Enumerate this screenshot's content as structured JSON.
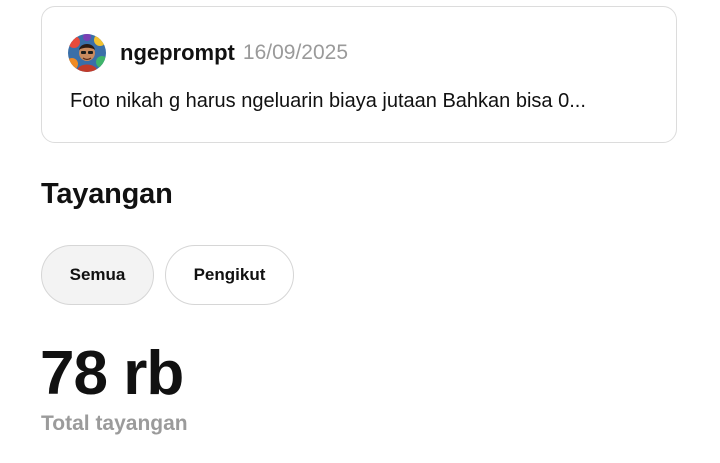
{
  "post": {
    "author": "ngeprompt",
    "date": "16/09/2025",
    "text": "Foto nikah g harus ngeluarin biaya jutaan Bahkan bisa 0..."
  },
  "views": {
    "title": "Tayangan",
    "filters": [
      "Semua",
      "Pengikut"
    ],
    "selected_filter": "Semua",
    "total_value": "78 rb",
    "total_label": "Total tayangan"
  },
  "colors": {
    "secondary_text": "#9a9a9a",
    "chip_selected_bg": "#f3f3f3",
    "border": "#dcdcdc"
  },
  "icons": {
    "avatar": "profile-avatar-illustration"
  }
}
